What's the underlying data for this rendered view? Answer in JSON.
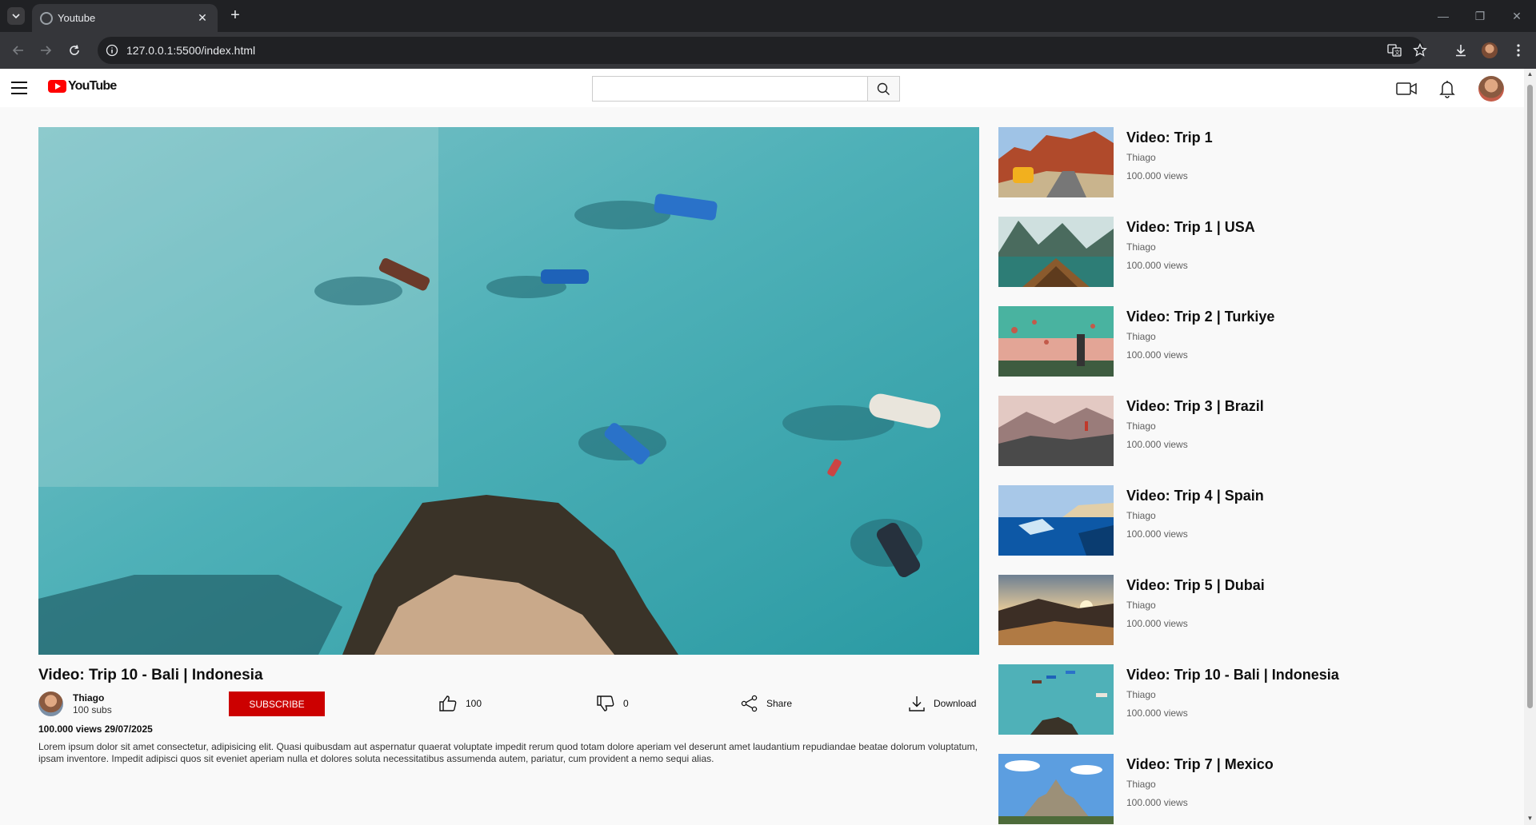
{
  "browser": {
    "tab_title": "Youtube",
    "url": "127.0.0.1:5500/index.html"
  },
  "header": {
    "logo_text": "YouTube",
    "search_placeholder": ""
  },
  "video": {
    "title": "Video: Trip 10 - Bali | Indonesia",
    "channel": "Thiago",
    "subs": "100 subs",
    "subscribe_label": "SUBSCRIBE",
    "likes": "100",
    "dislikes": "0",
    "share_label": "Share",
    "download_label": "Download",
    "meta": "100.000 views 29/07/2025",
    "description": "Lorem ipsum dolor sit amet consectetur, adipisicing elit. Quasi quibusdam aut aspernatur quaerat voluptate impedit rerum quod totam dolore aperiam vel deserunt amet laudantium repudiandae beatae dolorum voluptatum, ipsam inventore. Impedit adipisci quos sit eveniet aperiam nulla et dolores soluta necessitatibus assumenda autem, pariatur, cum provident a nemo sequi alias."
  },
  "related": [
    {
      "title": "Video: Trip 1",
      "channel": "Thiago",
      "views": "100.000 views",
      "thumb": "canyon-road"
    },
    {
      "title": "Video: Trip 1 | USA",
      "channel": "Thiago",
      "views": "100.000 views",
      "thumb": "lake-boat"
    },
    {
      "title": "Video: Trip 2 | Turkiye",
      "channel": "Thiago",
      "views": "100.000 views",
      "thumb": "balloons"
    },
    {
      "title": "Video: Trip 3 | Brazil",
      "channel": "Thiago",
      "views": "100.000 views",
      "thumb": "rocky-hills"
    },
    {
      "title": "Video: Trip 4 | Spain",
      "channel": "Thiago",
      "views": "100.000 views",
      "thumb": "underwater"
    },
    {
      "title": "Video: Trip 5 | Dubai",
      "channel": "Thiago",
      "views": "100.000 views",
      "thumb": "desert-sunset"
    },
    {
      "title": "Video: Trip 10 - Bali | Indonesia",
      "channel": "Thiago",
      "views": "100.000 views",
      "thumb": "turquoise-sea"
    },
    {
      "title": "Video: Trip 7 | Mexico",
      "channel": "Thiago",
      "views": "100.000 views",
      "thumb": "pyramid"
    }
  ],
  "colors": {
    "subscribe": "#cc0000",
    "brand_red": "#ff0000",
    "browser_dark": "#202124"
  }
}
